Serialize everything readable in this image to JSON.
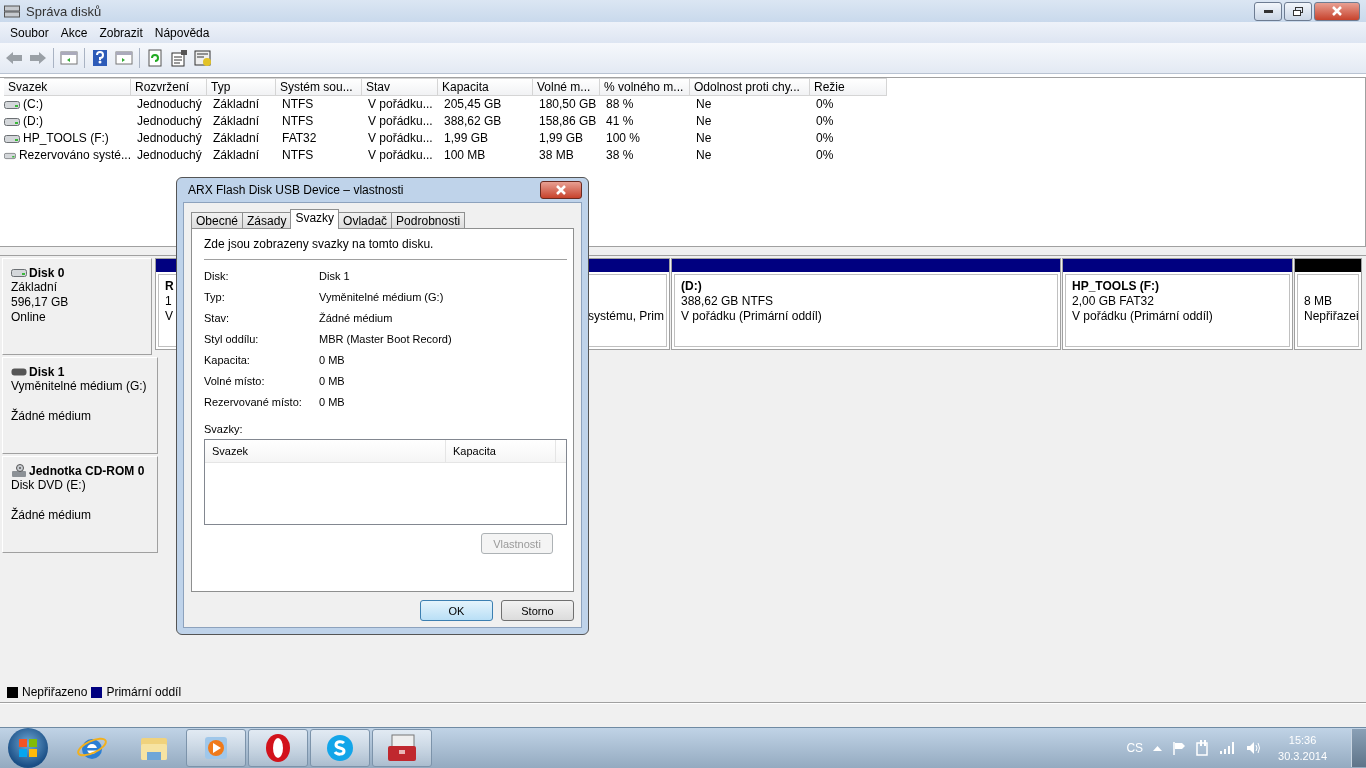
{
  "window": {
    "title": "Správa disků"
  },
  "menu": [
    "Soubor",
    "Akce",
    "Zobrazit",
    "Nápověda"
  ],
  "volume_table": {
    "columns": [
      "Svazek",
      "Rozvržení",
      "Typ",
      "Systém sou...",
      "Stav",
      "Kapacita",
      "Volné m...",
      "% volného m...",
      "Odolnost proti chy...",
      "Režie"
    ],
    "rows": [
      [
        "(C:)",
        "Jednoduchý",
        "Základní",
        "NTFS",
        "V pořádku...",
        "205,45 GB",
        "180,50 GB",
        "88 %",
        "Ne",
        "0%"
      ],
      [
        "(D:)",
        "Jednoduchý",
        "Základní",
        "NTFS",
        "V pořádku...",
        "388,62 GB",
        "158,86 GB",
        "41 %",
        "Ne",
        "0%"
      ],
      [
        "HP_TOOLS (F:)",
        "Jednoduchý",
        "Základní",
        "FAT32",
        "V pořádku...",
        "1,99 GB",
        "1,99 GB",
        "100 %",
        "Ne",
        "0%"
      ],
      [
        "Rezervováno systé...",
        "Jednoduchý",
        "Základní",
        "NTFS",
        "V pořádku...",
        "100 MB",
        "38 MB",
        "38 %",
        "Ne",
        "0%"
      ]
    ]
  },
  "disks": [
    {
      "kind": "fixed",
      "name": "Disk 0",
      "lines": [
        "Základní",
        "596,17 GB",
        "Online"
      ],
      "partitions": [
        {
          "kind": "primary",
          "lines": [
            "R",
            "1",
            "V"
          ]
        },
        {
          "kind": "primary",
          "lines": [
            "systému, Prim"
          ]
        },
        {
          "kind": "primary",
          "lines": [
            "(D:)",
            "388,62 GB NTFS",
            "V pořádku (Primární oddíl)"
          ]
        },
        {
          "kind": "primary",
          "lines": [
            "HP_TOOLS  (F:)",
            "2,00 GB FAT32",
            "V pořádku (Primární oddíl)"
          ]
        },
        {
          "kind": "unallocated",
          "lines": [
            "8 MB",
            "Nepřiřazei"
          ]
        }
      ]
    },
    {
      "kind": "removable",
      "name": "Disk 1",
      "lines": [
        "Vyměnitelné médium (G:)",
        "Žádné médium"
      ]
    },
    {
      "kind": "cdrom",
      "name": "Jednotka CD-ROM 0",
      "lines": [
        "Disk DVD (E:)",
        "Žádné médium"
      ]
    }
  ],
  "legend": [
    {
      "label": "Nepřiřazeno",
      "color": "#000000"
    },
    {
      "label": "Primární oddíl",
      "color": "#000080"
    }
  ],
  "dialog": {
    "title": "ARX Flash  Disk USB Device – vlastnosti",
    "tabs": [
      {
        "label": "Obecné",
        "selected": false
      },
      {
        "label": "Zásady",
        "selected": false
      },
      {
        "label": "Svazky",
        "selected": true
      },
      {
        "label": "Ovladač",
        "selected": false
      },
      {
        "label": "Podrobnosti",
        "selected": false
      }
    ],
    "intro": "Zde jsou zobrazeny svazky na tomto disku.",
    "info": [
      {
        "label": "Disk:",
        "value": "Disk 1"
      },
      {
        "label": "Typ:",
        "value": "Vyměnitelné médium (G:)"
      },
      {
        "label": "Stav:",
        "value": "Žádné médium"
      },
      {
        "label": "Styl oddílu:",
        "value": "MBR (Master Boot Record)"
      },
      {
        "label": "Kapacita:",
        "value": "0 MB"
      },
      {
        "label": "Volné místo:",
        "value": "0 MB"
      },
      {
        "label": "Rezervované místo:",
        "value": "0 MB"
      }
    ],
    "volumes_label": "Svazky:",
    "volumes_columns": [
      "Svazek",
      "Kapacita"
    ],
    "properties_button": {
      "label": "Vlastnosti",
      "disabled": true
    },
    "ok_button": "OK",
    "cancel_button": "Storno"
  },
  "taskbar": {
    "apps": [
      {
        "kind": "ie",
        "active": false
      },
      {
        "kind": "explorer",
        "active": false
      },
      {
        "kind": "media",
        "active": true
      },
      {
        "kind": "opera",
        "active": true
      },
      {
        "kind": "skype",
        "active": true
      },
      {
        "kind": "toolbox",
        "active": true
      }
    ],
    "language": "CS",
    "time": "15:36",
    "date": "30.3.2014"
  }
}
